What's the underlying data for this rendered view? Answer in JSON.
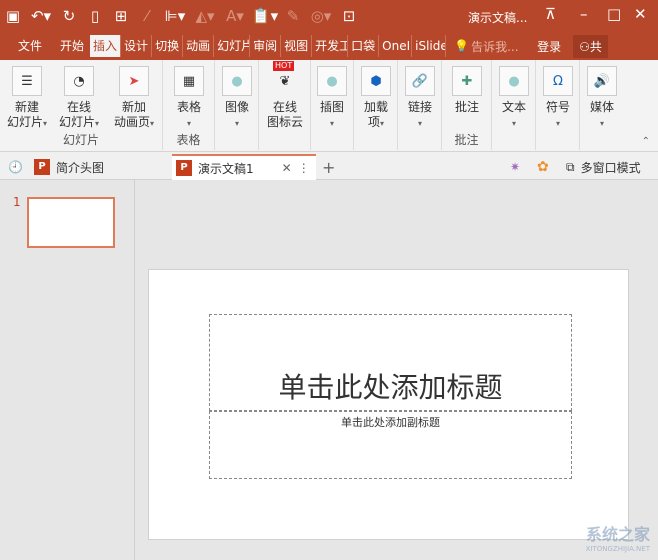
{
  "window": {
    "title": "演示文稿...",
    "colors": {
      "accent": "#b7472a"
    }
  },
  "quick_access": [
    "save-icon",
    "undo-icon",
    "redo-icon",
    "new-icon",
    "grid-icon",
    "eyedropper-icon",
    "align-icon",
    "fill-icon",
    "font-color-icon",
    "paste-icon",
    "format-painter-icon",
    "shape-icon",
    "fit-icon"
  ],
  "menu": {
    "items": [
      "文件",
      "开始",
      "插入",
      "设计",
      "切换",
      "动画",
      "幻灯片",
      "审阅",
      "视图",
      "开发工",
      "口袋",
      "OneI",
      "iSlide"
    ],
    "active": "插入",
    "tell_me": "告诉我...",
    "login": "登录",
    "share": "共"
  },
  "ribbon": {
    "groups": [
      {
        "label": "幻灯片",
        "buttons": [
          {
            "label": "新建\n幻灯片"
          },
          {
            "label": "在线\n幻灯片"
          },
          {
            "label": "新加\n动画页"
          }
        ]
      },
      {
        "label": "表格",
        "buttons": [
          {
            "label": "表格"
          }
        ]
      },
      {
        "label": "",
        "buttons": [
          {
            "label": "图像"
          }
        ]
      },
      {
        "label": "",
        "buttons": [
          {
            "label": "在线\n图标云",
            "badge": "HOT"
          }
        ]
      },
      {
        "label": "",
        "buttons": [
          {
            "label": "插图"
          }
        ]
      },
      {
        "label": "",
        "buttons": [
          {
            "label": "加载\n项"
          }
        ]
      },
      {
        "label": "",
        "buttons": [
          {
            "label": "链接"
          }
        ]
      },
      {
        "label": "批注",
        "buttons": [
          {
            "label": "批注"
          }
        ]
      },
      {
        "label": "",
        "buttons": [
          {
            "label": "文本"
          }
        ]
      },
      {
        "label": "",
        "buttons": [
          {
            "label": "符号"
          }
        ]
      },
      {
        "label": "",
        "buttons": [
          {
            "label": "媒体"
          }
        ]
      }
    ]
  },
  "doc_tabs": {
    "tabs": [
      {
        "label": "简介头图"
      },
      {
        "label": "演示文稿1",
        "active": true
      }
    ],
    "multi_window": "多窗口模式"
  },
  "slides_panel": {
    "number": "1"
  },
  "slide": {
    "title_placeholder": "单击此处添加标题",
    "subtitle_placeholder": "单击此处添加副标题"
  },
  "watermark": {
    "text": "系统之家",
    "sub": "XITONGZHIJIA.NET"
  }
}
